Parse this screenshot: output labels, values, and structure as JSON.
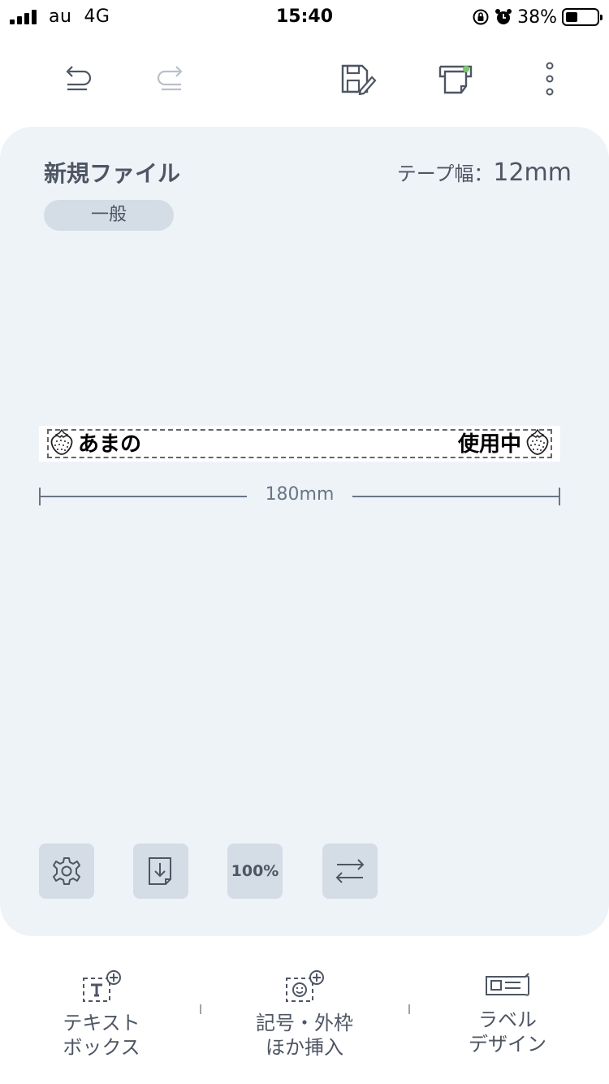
{
  "status_bar": {
    "carrier": "au",
    "network": "4G",
    "time": "15:40",
    "battery_percent": "38%",
    "battery_level": 0.38
  },
  "toolbar": {
    "undo_icon": "undo-icon",
    "redo_icon": "redo-icon",
    "save_icon": "save-edit-icon",
    "print_icon": "printer-icon",
    "more_icon": "more-vertical-icon"
  },
  "editor": {
    "file_title": "新規ファイル",
    "tape_width_label": "テープ幅：",
    "tape_width_value": "12mm",
    "category": "一般",
    "label_text_left": "あまの",
    "label_text_right": "使用中",
    "label_length": "180mm",
    "zoom": "100%"
  },
  "bottom_nav": {
    "text_box": {
      "line1": "テキスト",
      "line2": "ボックス"
    },
    "symbol_insert": {
      "line1": "記号・外枠",
      "line2": "ほか挿入"
    },
    "label_design": {
      "line1": "ラベル",
      "line2": "デザイン"
    }
  },
  "colors": {
    "card_bg": "#eef3f8",
    "button_bg": "#d4dde6",
    "text": "#4e5663",
    "print_indicator": "#7bc86c"
  }
}
